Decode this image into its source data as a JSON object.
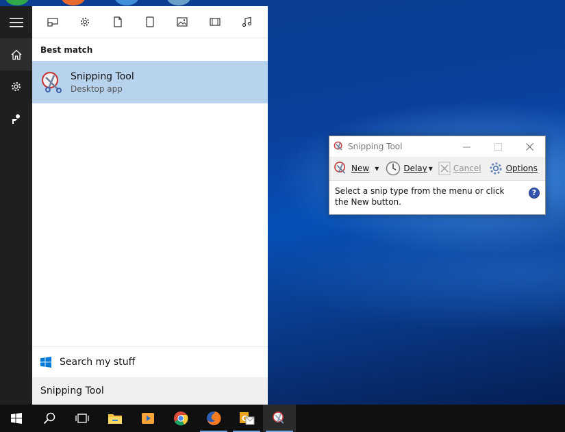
{
  "search_panel": {
    "best_match_label": "Best match",
    "result": {
      "title": "Snipping Tool",
      "subtitle": "Desktop app"
    },
    "search_my_stuff": "Search my stuff",
    "search_query": "Snipping Tool"
  },
  "snipping_tool": {
    "title": "Snipping Tool",
    "toolbar": {
      "new_label": "New",
      "delay_label": "Delay",
      "cancel_label": "Cancel",
      "options_label": "Options"
    },
    "message": "Select a snip type from the menu or click the New button.",
    "help_glyph": "?"
  },
  "icons": {
    "rail": [
      "hamburger-menu-icon",
      "home-icon",
      "gear-icon",
      "feedback-icon"
    ],
    "filters": [
      "apps-icon",
      "settings-icon",
      "documents-icon",
      "tablet-icon",
      "photos-icon",
      "videos-icon",
      "music-icon"
    ],
    "taskbar": [
      "windows-start-icon",
      "search-icon",
      "task-view-icon",
      "file-explorer-icon",
      "media-player-icon",
      "chrome-icon",
      "firefox-icon",
      "outlook-icon",
      "snipping-tool-icon"
    ]
  },
  "colors": {
    "selection": "#b8d3ed",
    "rail_bg": "#1f1f1f",
    "taskbar_bg": "#101010",
    "accent": "#76a9e6"
  }
}
